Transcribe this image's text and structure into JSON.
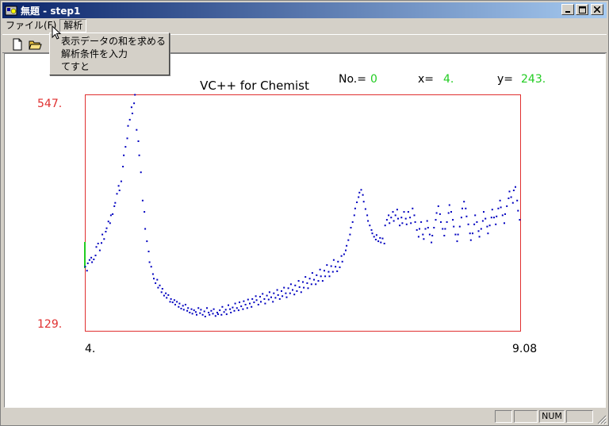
{
  "window": {
    "title": "無題 - step1"
  },
  "menu": {
    "items": [
      "ファイル(F)",
      "解析"
    ],
    "active_index": 1
  },
  "dropdown": {
    "items": [
      "表示データの和を求める",
      "解析条件を入力",
      "てすと"
    ]
  },
  "toolbar": {
    "icons": [
      "new-document-icon",
      "open-folder-icon"
    ]
  },
  "plot": {
    "title": "VC++ for Chemist",
    "no_label": "No.=",
    "no_value": "0",
    "x_label": "x=",
    "x_value": "4.",
    "y_label": "y=",
    "y_value": "243.",
    "y_max_label": "547.",
    "y_min_label": "129.",
    "x_min_label": "4.",
    "x_max_label": "9.08",
    "colors": {
      "frame": "#e03030",
      "points": "#0000c0",
      "values": "#22cc22",
      "axis_labels": "#e03030",
      "cursor": "#22cc22"
    }
  },
  "chart_data": {
    "type": "scatter",
    "title": "VC++ for Chemist",
    "xlim": [
      4.0,
      9.08
    ],
    "ylim": [
      129,
      547
    ],
    "points": [
      [
        4.0,
        243
      ],
      [
        4.02,
        236
      ],
      [
        4.03,
        249
      ],
      [
        4.05,
        255
      ],
      [
        4.07,
        259
      ],
      [
        4.08,
        251
      ],
      [
        4.1,
        256
      ],
      [
        4.12,
        263
      ],
      [
        4.13,
        278
      ],
      [
        4.15,
        284
      ],
      [
        4.17,
        272
      ],
      [
        4.19,
        285
      ],
      [
        4.2,
        300
      ],
      [
        4.22,
        292
      ],
      [
        4.24,
        305
      ],
      [
        4.25,
        311
      ],
      [
        4.27,
        323
      ],
      [
        4.29,
        320
      ],
      [
        4.3,
        334
      ],
      [
        4.32,
        336
      ],
      [
        4.34,
        350
      ],
      [
        4.35,
        356
      ],
      [
        4.37,
        372
      ],
      [
        4.39,
        386
      ],
      [
        4.4,
        378
      ],
      [
        4.42,
        394
      ],
      [
        4.44,
        420
      ],
      [
        4.45,
        440
      ],
      [
        4.47,
        455
      ],
      [
        4.49,
        470
      ],
      [
        4.5,
        492
      ],
      [
        4.52,
        503
      ],
      [
        4.54,
        525
      ],
      [
        4.55,
        514
      ],
      [
        4.57,
        532
      ],
      [
        4.58,
        547
      ],
      [
        4.6,
        485
      ],
      [
        4.62,
        465
      ],
      [
        4.63,
        440
      ],
      [
        4.65,
        410
      ],
      [
        4.67,
        360
      ],
      [
        4.69,
        340
      ],
      [
        4.7,
        310
      ],
      [
        4.72,
        288
      ],
      [
        4.74,
        270
      ],
      [
        4.75,
        251
      ],
      [
        4.77,
        243
      ],
      [
        4.79,
        230
      ],
      [
        4.8,
        222
      ],
      [
        4.82,
        214
      ],
      [
        4.84,
        220
      ],
      [
        4.85,
        206
      ],
      [
        4.87,
        210
      ],
      [
        4.89,
        198
      ],
      [
        4.9,
        204
      ],
      [
        4.92,
        192
      ],
      [
        4.94,
        196
      ],
      [
        4.95,
        188
      ],
      [
        4.97,
        193
      ],
      [
        4.99,
        181
      ],
      [
        5.0,
        186
      ],
      [
        5.02,
        180
      ],
      [
        5.04,
        184
      ],
      [
        5.05,
        176
      ],
      [
        5.07,
        181
      ],
      [
        5.09,
        172
      ],
      [
        5.1,
        178
      ],
      [
        5.12,
        169
      ],
      [
        5.14,
        174
      ],
      [
        5.15,
        167
      ],
      [
        5.17,
        176
      ],
      [
        5.19,
        165
      ],
      [
        5.2,
        170
      ],
      [
        5.22,
        162
      ],
      [
        5.24,
        168
      ],
      [
        5.25,
        160
      ],
      [
        5.27,
        166
      ],
      [
        5.29,
        163
      ],
      [
        5.3,
        158
      ],
      [
        5.32,
        170
      ],
      [
        5.34,
        161
      ],
      [
        5.35,
        167
      ],
      [
        5.37,
        158
      ],
      [
        5.39,
        164
      ],
      [
        5.4,
        155
      ],
      [
        5.42,
        170
      ],
      [
        5.44,
        162
      ],
      [
        5.45,
        158
      ],
      [
        5.47,
        165
      ],
      [
        5.49,
        160
      ],
      [
        5.5,
        168
      ],
      [
        5.52,
        156
      ],
      [
        5.54,
        162
      ],
      [
        5.55,
        159
      ],
      [
        5.57,
        166
      ],
      [
        5.59,
        158
      ],
      [
        5.6,
        172
      ],
      [
        5.62,
        163
      ],
      [
        5.64,
        167
      ],
      [
        5.65,
        159
      ],
      [
        5.67,
        175
      ],
      [
        5.69,
        168
      ],
      [
        5.7,
        162
      ],
      [
        5.72,
        171
      ],
      [
        5.74,
        165
      ],
      [
        5.75,
        178
      ],
      [
        5.77,
        170
      ],
      [
        5.79,
        166
      ],
      [
        5.8,
        180
      ],
      [
        5.82,
        173
      ],
      [
        5.84,
        168
      ],
      [
        5.85,
        182
      ],
      [
        5.87,
        176
      ],
      [
        5.89,
        170
      ],
      [
        5.9,
        185
      ],
      [
        5.92,
        178
      ],
      [
        5.94,
        172
      ],
      [
        5.95,
        186
      ],
      [
        5.97,
        180
      ],
      [
        5.99,
        191
      ],
      [
        6.0,
        184
      ],
      [
        6.02,
        176
      ],
      [
        6.04,
        190
      ],
      [
        6.05,
        181
      ],
      [
        6.07,
        195
      ],
      [
        6.09,
        186
      ],
      [
        6.1,
        178
      ],
      [
        6.12,
        192
      ],
      [
        6.14,
        185
      ],
      [
        6.15,
        198
      ],
      [
        6.17,
        189
      ],
      [
        6.19,
        181
      ],
      [
        6.2,
        196
      ],
      [
        6.22,
        188
      ],
      [
        6.24,
        202
      ],
      [
        6.25,
        193
      ],
      [
        6.27,
        186
      ],
      [
        6.29,
        200
      ],
      [
        6.3,
        191
      ],
      [
        6.32,
        206
      ],
      [
        6.34,
        196
      ],
      [
        6.35,
        189
      ],
      [
        6.37,
        205
      ],
      [
        6.39,
        196
      ],
      [
        6.4,
        212
      ],
      [
        6.42,
        202
      ],
      [
        6.44,
        194
      ],
      [
        6.45,
        210
      ],
      [
        6.47,
        200
      ],
      [
        6.49,
        218
      ],
      [
        6.5,
        207
      ],
      [
        6.52,
        198
      ],
      [
        6.54,
        216
      ],
      [
        6.55,
        206
      ],
      [
        6.57,
        225
      ],
      [
        6.59,
        214
      ],
      [
        6.6,
        205
      ],
      [
        6.62,
        222
      ],
      [
        6.64,
        212
      ],
      [
        6.65,
        232
      ],
      [
        6.67,
        220
      ],
      [
        6.69,
        212
      ],
      [
        6.7,
        228
      ],
      [
        6.72,
        218
      ],
      [
        6.74,
        238
      ],
      [
        6.75,
        226
      ],
      [
        6.77,
        218
      ],
      [
        6.79,
        236
      ],
      [
        6.8,
        226
      ],
      [
        6.82,
        246
      ],
      [
        6.84,
        234
      ],
      [
        6.85,
        226
      ],
      [
        6.87,
        244
      ],
      [
        6.89,
        234
      ],
      [
        6.9,
        255
      ],
      [
        6.92,
        243
      ],
      [
        6.94,
        235
      ],
      [
        6.95,
        252
      ],
      [
        6.97,
        242
      ],
      [
        6.99,
        262
      ],
      [
        7.0,
        252
      ],
      [
        7.02,
        265
      ],
      [
        7.04,
        272
      ],
      [
        7.05,
        280
      ],
      [
        7.07,
        290
      ],
      [
        7.09,
        300
      ],
      [
        7.1,
        312
      ],
      [
        7.12,
        322
      ],
      [
        7.14,
        334
      ],
      [
        7.15,
        346
      ],
      [
        7.17,
        357
      ],
      [
        7.19,
        366
      ],
      [
        7.2,
        374
      ],
      [
        7.22,
        379
      ],
      [
        7.24,
        370
      ],
      [
        7.25,
        358
      ],
      [
        7.27,
        345
      ],
      [
        7.29,
        334
      ],
      [
        7.3,
        324
      ],
      [
        7.32,
        316
      ],
      [
        7.34,
        308
      ],
      [
        7.35,
        302
      ],
      [
        7.37,
        296
      ],
      [
        7.39,
        291
      ],
      [
        7.4,
        299
      ],
      [
        7.42,
        288
      ],
      [
        7.44,
        294
      ],
      [
        7.45,
        286
      ],
      [
        7.47,
        293
      ],
      [
        7.49,
        284
      ],
      [
        7.5,
        316
      ],
      [
        7.52,
        326
      ],
      [
        7.54,
        334
      ],
      [
        7.55,
        320
      ],
      [
        7.57,
        330
      ],
      [
        7.59,
        340
      ],
      [
        7.6,
        324
      ],
      [
        7.62,
        334
      ],
      [
        7.64,
        344
      ],
      [
        7.65,
        328
      ],
      [
        7.67,
        316
      ],
      [
        7.69,
        330
      ],
      [
        7.7,
        320
      ],
      [
        7.72,
        340
      ],
      [
        7.74,
        328
      ],
      [
        7.75,
        318
      ],
      [
        7.77,
        340
      ],
      [
        7.79,
        330
      ],
      [
        7.8,
        320
      ],
      [
        7.82,
        346
      ],
      [
        7.84,
        334
      ],
      [
        7.85,
        322
      ],
      [
        7.87,
        308
      ],
      [
        7.89,
        296
      ],
      [
        7.9,
        310
      ],
      [
        7.92,
        322
      ],
      [
        7.94,
        300
      ],
      [
        7.95,
        292
      ],
      [
        7.97,
        310
      ],
      [
        7.99,
        324
      ],
      [
        8.0,
        312
      ],
      [
        8.02,
        300
      ],
      [
        8.04,
        286
      ],
      [
        8.05,
        298
      ],
      [
        8.07,
        312
      ],
      [
        8.09,
        326
      ],
      [
        8.1,
        338
      ],
      [
        8.12,
        350
      ],
      [
        8.14,
        336
      ],
      [
        8.15,
        322
      ],
      [
        8.17,
        310
      ],
      [
        8.19,
        298
      ],
      [
        8.2,
        310
      ],
      [
        8.22,
        322
      ],
      [
        8.24,
        338
      ],
      [
        8.25,
        352
      ],
      [
        8.27,
        340
      ],
      [
        8.29,
        326
      ],
      [
        8.3,
        314
      ],
      [
        8.32,
        300
      ],
      [
        8.34,
        288
      ],
      [
        8.35,
        300
      ],
      [
        8.37,
        314
      ],
      [
        8.39,
        330
      ],
      [
        8.4,
        346
      ],
      [
        8.42,
        358
      ],
      [
        8.44,
        346
      ],
      [
        8.45,
        332
      ],
      [
        8.47,
        318
      ],
      [
        8.49,
        302
      ],
      [
        8.5,
        290
      ],
      [
        8.52,
        302
      ],
      [
        8.54,
        318
      ],
      [
        8.55,
        334
      ],
      [
        8.57,
        322
      ],
      [
        8.59,
        306
      ],
      [
        8.6,
        296
      ],
      [
        8.62,
        310
      ],
      [
        8.64,
        324
      ],
      [
        8.65,
        340
      ],
      [
        8.67,
        328
      ],
      [
        8.69,
        314
      ],
      [
        8.7,
        302
      ],
      [
        8.72,
        316
      ],
      [
        8.74,
        330
      ],
      [
        8.75,
        344
      ],
      [
        8.77,
        330
      ],
      [
        8.79,
        318
      ],
      [
        8.8,
        332
      ],
      [
        8.82,
        346
      ],
      [
        8.84,
        360
      ],
      [
        8.85,
        348
      ],
      [
        8.87,
        334
      ],
      [
        8.89,
        320
      ],
      [
        8.9,
        336
      ],
      [
        8.92,
        350
      ],
      [
        8.94,
        364
      ],
      [
        8.95,
        376
      ],
      [
        8.97,
        366
      ],
      [
        8.99,
        356
      ],
      [
        9.0,
        378
      ],
      [
        9.02,
        384
      ],
      [
        9.04,
        360
      ],
      [
        9.05,
        342
      ],
      [
        9.07,
        326
      ]
    ]
  }
}
